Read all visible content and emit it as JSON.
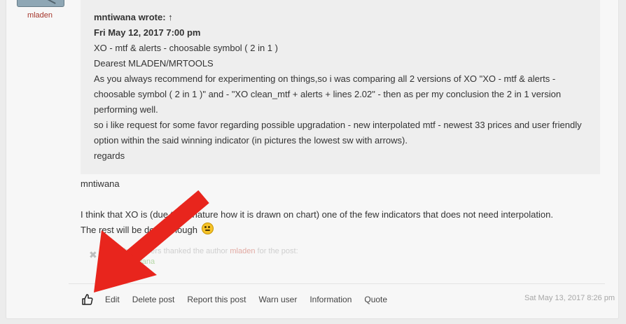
{
  "author": {
    "name": "mladen"
  },
  "quote": {
    "cite": "mntiwana wrote: ↑",
    "date": "Fri May 12, 2017 7:00 pm",
    "lines": [
      "XO - mtf & alerts - choosable symbol ( 2 in 1 )",
      "Dearest MLADEN/MRTOOLS",
      "As you always recommend for experimenting on things,so i was comparing all 2 versions of XO \"XO - mtf & alerts - choosable symbol ( 2 in 1 )\" and - \"XO clean_mtf + alerts + lines 2.02\" - then as per my conclusion the 2 in 1 version performing well.",
      "so i like request for some favor regarding possible upgradation - new interpolated mtf - newest 33 prices and user friendly option within the said winning indicator (in pictures the lowest sw with arrows).",
      "regards"
    ]
  },
  "body": {
    "addressee": "mntiwana",
    "line1": "I think that XO is (due to its nature how it is drawn on chart) one of the few indicators that does not need interpolation.",
    "line2": "The rest will be done, though"
  },
  "thanks": {
    "prefix": "These users thanked the author",
    "author": "mladen",
    "suffix": "for the post:",
    "users": [
      "mntiwana"
    ]
  },
  "actions": {
    "edit": "Edit",
    "delete": "Delete post",
    "report": "Report this post",
    "warn": "Warn user",
    "information": "Information",
    "quote": "Quote"
  },
  "post_date": "Sat May 13, 2017 8:26 pm",
  "icons": {
    "like": "thumbs-up-icon",
    "remove": "close-icon",
    "emoji": "wink-smiley-icon"
  },
  "colors": {
    "author_name": "#a5362b",
    "annotation_arrow": "#e8251d",
    "thanks_author": "#e2aaa3",
    "thanks_user": "#b6d8a8"
  }
}
